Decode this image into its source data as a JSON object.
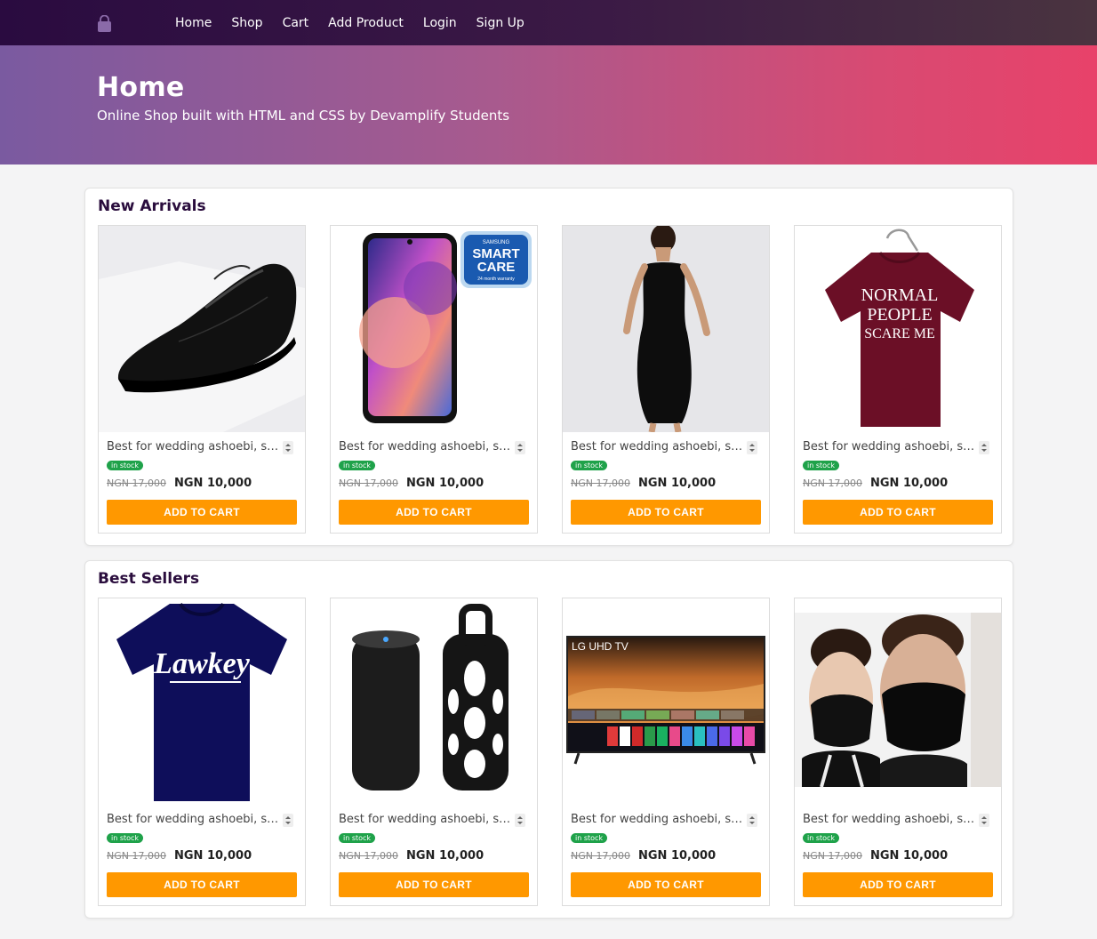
{
  "nav": {
    "links": [
      "Home",
      "Shop",
      "Cart",
      "Add Product",
      "Login",
      "Sign Up"
    ]
  },
  "hero": {
    "title": "Home",
    "subtitle": "Online Shop built with HTML and CSS by Devamplify Students"
  },
  "colors": {
    "accent": "#ff9800",
    "stock": "#1fa24a",
    "nav": "#2a0b40",
    "section_title": "#2a0d3d"
  },
  "sections": [
    {
      "title": "New Arrivals",
      "products": [
        {
          "image": "shoe-image",
          "name": "Best for wedding ashoebi, sch...",
          "badge": "in stock",
          "old_price": "NGN 17,000",
          "price": "NGN 10,000",
          "button": "ADD TO CART"
        },
        {
          "image": "phone-image",
          "name": "Best for wedding ashoebi, sch...",
          "badge": "in stock",
          "old_price": "NGN 17,000",
          "price": "NGN 10,000",
          "button": "ADD TO CART",
          "image_text": [
            "SAMSUNG",
            "SMART",
            "CARE",
            "24 month warranty"
          ]
        },
        {
          "image": "dress-image",
          "name": "Best for wedding ashoebi, sch...",
          "badge": "in stock",
          "old_price": "NGN 17,000",
          "price": "NGN 10,000",
          "button": "ADD TO CART"
        },
        {
          "image": "tshirt-image",
          "name": "Best for wedding ashoebi, sch...",
          "badge": "in stock",
          "old_price": "NGN 17,000",
          "price": "NGN 10,000",
          "button": "ADD TO CART",
          "image_text": [
            "NORMAL",
            "PEOPLE",
            "SCARE ME"
          ]
        }
      ]
    },
    {
      "title": "Best Sellers",
      "products": [
        {
          "image": "navy-tshirt-image",
          "name": "Best for wedding ashoebi, sch...",
          "badge": "in stock",
          "old_price": "NGN 17,000",
          "price": "NGN 10,000",
          "button": "ADD TO CART",
          "image_text": [
            "Lawkey"
          ]
        },
        {
          "image": "speaker-image",
          "name": "Best for wedding ashoebi, sch...",
          "badge": "in stock",
          "old_price": "NGN 17,000",
          "price": "NGN 10,000",
          "button": "ADD TO CART"
        },
        {
          "image": "tv-image",
          "name": "Best for wedding ashoebi, sch...",
          "badge": "in stock",
          "old_price": "NGN 17,000",
          "price": "NGN 10,000",
          "button": "ADD TO CART",
          "image_text": [
            "LG UHD TV"
          ]
        },
        {
          "image": "face-mask-image",
          "name": "Best for wedding ashoebi, sch...",
          "badge": "in stock",
          "old_price": "NGN 17,000",
          "price": "NGN 10,000",
          "button": "ADD TO CART"
        }
      ]
    }
  ]
}
